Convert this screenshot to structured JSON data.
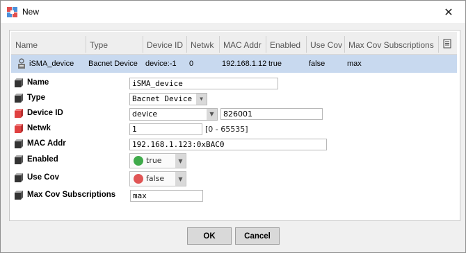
{
  "window": {
    "title": "New"
  },
  "table": {
    "headers": [
      "Name",
      "Type",
      "Device ID",
      "Netwk",
      "MAC Addr",
      "Enabled",
      "Use Cov",
      "Max Cov Subscriptions"
    ],
    "row": [
      "iSMA_device",
      "Bacnet Device",
      "device:-1",
      "0",
      "192.168.1.12",
      "true",
      "false",
      "max"
    ]
  },
  "props": {
    "name": {
      "label": "Name",
      "value": "iSMA_device"
    },
    "type": {
      "label": "Type",
      "value": "Bacnet Device"
    },
    "device_id": {
      "label": "Device ID",
      "type_value": "device",
      "number": "826001"
    },
    "netwk": {
      "label": "Netwk",
      "value": "1",
      "range": "[0 - 65535]"
    },
    "mac_addr": {
      "label": "MAC Addr",
      "value": "192.168.1.123:0xBAC0"
    },
    "enabled": {
      "label": "Enabled",
      "value": "true",
      "color": "#3faa4a"
    },
    "use_cov": {
      "label": "Use Cov",
      "value": "false",
      "color": "#e05555"
    },
    "max_cov": {
      "label": "Max Cov Subscriptions",
      "value": "max"
    }
  },
  "buttons": {
    "ok": "OK",
    "cancel": "Cancel"
  },
  "icons": {
    "app": "niagara-app-icon",
    "close": "close-icon",
    "row": "device-icon",
    "column_menu": "column-chooser-icon",
    "property_normal": "slot-icon",
    "property_required": "required-slot-icon"
  },
  "colors": {
    "selected_row": "#c8d9ef",
    "enabled_dot": "#3faa4a",
    "disabled_dot": "#e05555"
  }
}
